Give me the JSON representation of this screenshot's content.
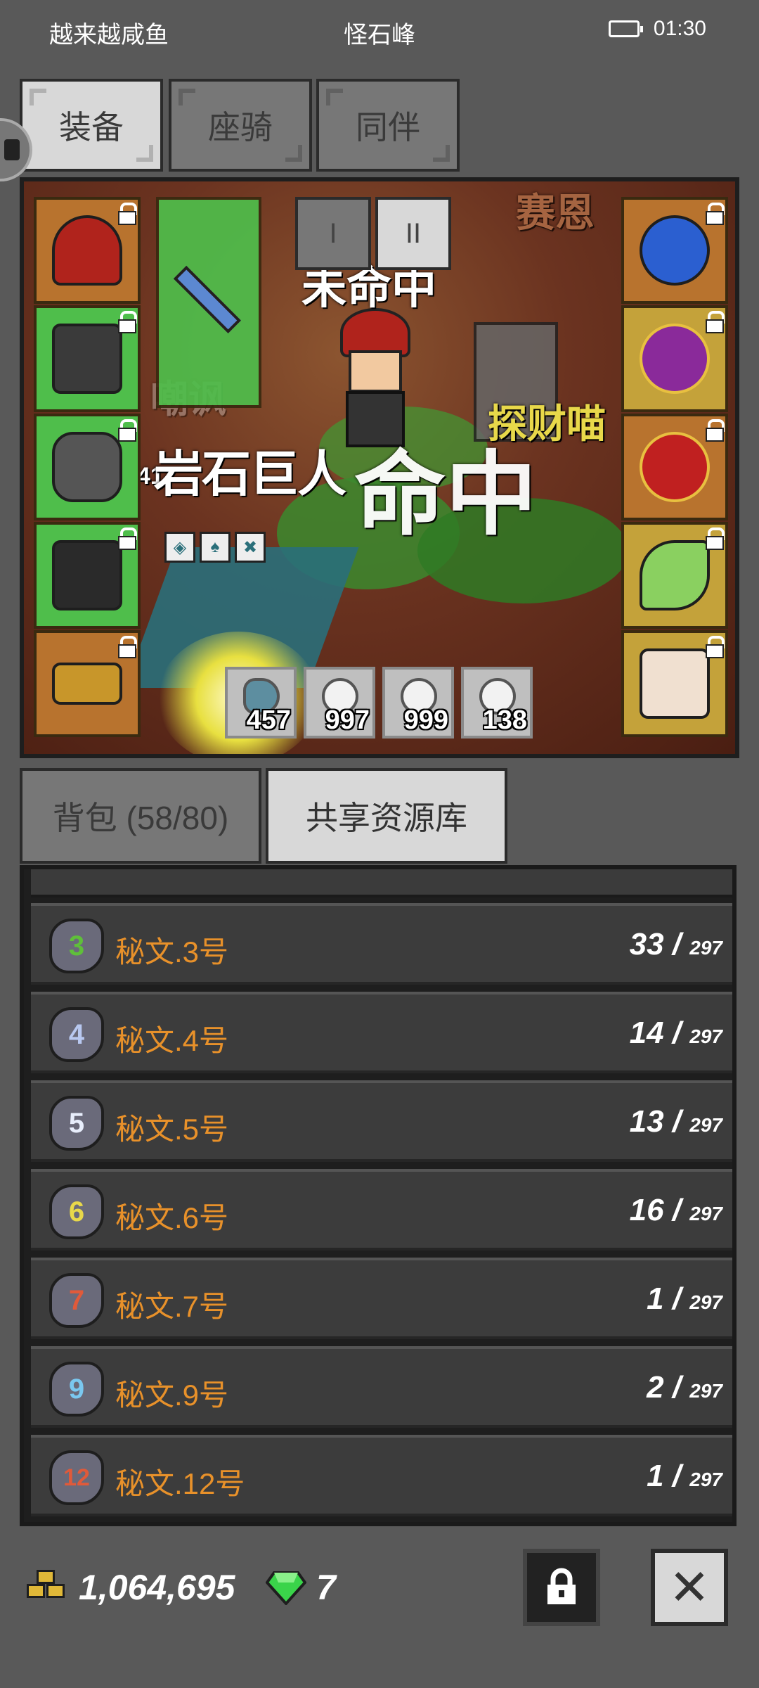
{
  "status_bar": {
    "left": "越来越咸鱼",
    "center": "怪石峰",
    "time": "01:30"
  },
  "top_tabs": [
    {
      "label": "装备",
      "active": true
    },
    {
      "label": "座骑",
      "active": false
    },
    {
      "label": "同伴",
      "active": false
    }
  ],
  "equip_panel": {
    "page_toggle": [
      {
        "label": "I",
        "active": false
      },
      {
        "label": "II",
        "active": true
      }
    ],
    "scene_text": {
      "status": "未命中",
      "enemy_name": "岩石巨人",
      "enemy_level": "241",
      "big_text": "命中",
      "right_text": "探财喵",
      "top_text": "赛恩",
      "ghost_text": "嘲讽"
    },
    "buff_icons": [
      "shield-buff",
      "ghost-buff",
      "skull-buff"
    ],
    "left_slots": [
      "helmet",
      "armor",
      "gauntlet",
      "boots",
      "belt"
    ],
    "right_slots": [
      "amulet",
      "ring",
      "ring-red",
      "green-charm",
      "cat-pet"
    ],
    "consumables": [
      {
        "icon": "fish",
        "count": "457"
      },
      {
        "icon": "potion",
        "count": "997"
      },
      {
        "icon": "potion",
        "count": "999"
      },
      {
        "icon": "potion",
        "count": "138"
      }
    ]
  },
  "bottom_tabs": [
    {
      "label": "背包 (58/80)",
      "active": false
    },
    {
      "label": "共享资源库",
      "active": true
    }
  ],
  "resources": [
    {
      "icon_num": "3",
      "icon_color": "#5fbf3a",
      "name": "秘文.3号",
      "count": "33 / ",
      "max": "297"
    },
    {
      "icon_num": "4",
      "icon_color": "#b8c8f0",
      "name": "秘文.4号",
      "count": "14 / ",
      "max": "297"
    },
    {
      "icon_num": "5",
      "icon_color": "#e8eefc",
      "name": "秘文.5号",
      "count": "13 / ",
      "max": "297"
    },
    {
      "icon_num": "6",
      "icon_color": "#e8d84a",
      "name": "秘文.6号",
      "count": "16 / ",
      "max": "297"
    },
    {
      "icon_num": "7",
      "icon_color": "#e05a3a",
      "name": "秘文.7号",
      "count": "1 / ",
      "max": "297"
    },
    {
      "icon_num": "9",
      "icon_color": "#7ac8f0",
      "name": "秘文.9号",
      "count": "2 / ",
      "max": "297"
    },
    {
      "icon_num": "12",
      "icon_color": "#e05a3a",
      "name": "秘文.12号",
      "count": "1 / ",
      "max": "297"
    }
  ],
  "footer": {
    "gold": "1,064,695",
    "gems": "7"
  }
}
